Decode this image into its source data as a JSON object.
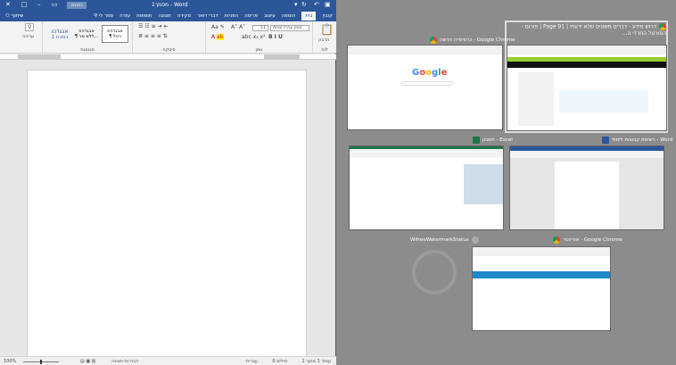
{
  "word": {
    "title": "מסמך1 - Word",
    "sign_in": "היכנס",
    "tabs": [
      "קובץ",
      "בית",
      "הוספה",
      "עיצוב",
      "פריסה",
      "הפניות",
      "דברי דואר",
      "סקירה",
      "תצוגה",
      "תוספות",
      "עזרה",
      "ספר לי"
    ],
    "share": "שיתוף",
    "ribbon": {
      "font_name": "Arial (גופן עברי)",
      "font_size": "11",
      "groups": [
        "לוח",
        "גופן",
        "פיסקה",
        "סגנונות",
        "עריכה"
      ],
      "paste": "הדבק",
      "styles": [
        {
          "sample": "אבגדהוז",
          "name": "¶ רגיל"
        },
        {
          "sample": "אבגדהוז",
          "name": "¶ ללא מר..."
        },
        {
          "sample": "אבגדהו",
          "name": "כותרת 1"
        }
      ],
      "editing": "עריכה"
    },
    "status": {
      "page": "עמוד 1 מתוך 1",
      "words": "0 מילים",
      "language": "עברית",
      "display_settings": "הגדרות תצוגה",
      "zoom": "100%"
    }
  },
  "snap_windows": [
    {
      "title": "דרוש מידע - דברים משונים שלא ידעתי | Page 91 | פורום - הפורטל החרדי ה...",
      "app": "chrome"
    },
    {
      "title": "כרטיסייה חדשה - Google Chrome",
      "app": "chrome",
      "content": "Google"
    },
    {
      "title": "רשימת קבוצות לימוד - Word",
      "app": "word"
    },
    {
      "title": "חשבון - Excel",
      "app": "excel"
    },
    {
      "title": "WifreeWatermarkStatus",
      "app": "wifree"
    },
    {
      "title": "אורינטר - Google Chrome",
      "app": "chrome"
    }
  ],
  "colors": {
    "word_blue": "#2b579a",
    "excel_green": "#217346",
    "bg": "#8c8c8c"
  }
}
